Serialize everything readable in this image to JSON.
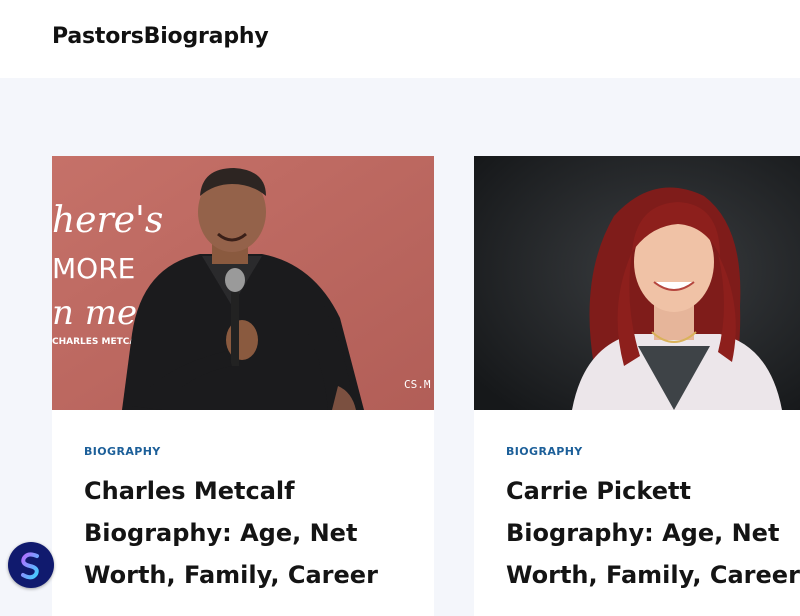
{
  "header": {
    "site_title": "PastorsBiography"
  },
  "posts": [
    {
      "category": "BIOGRAPHY",
      "title": "Charles Metcalf Biography: Age, Net Worth, Family, Career",
      "image_text": [
        "here's",
        "MORE",
        "n me",
        "CHARLES METCALF",
        "CS.M"
      ]
    },
    {
      "category": "BIOGRAPHY",
      "title": "Carrie Pickett Biography: Age, Net Worth, Family, Career"
    }
  ],
  "colors": {
    "page_bg": "#f4f6fb",
    "category": "#1c5f99",
    "title": "#141414",
    "badge_bg": "#101a6e"
  },
  "icons": {
    "floating_badge": "brand-s-logo-icon"
  }
}
